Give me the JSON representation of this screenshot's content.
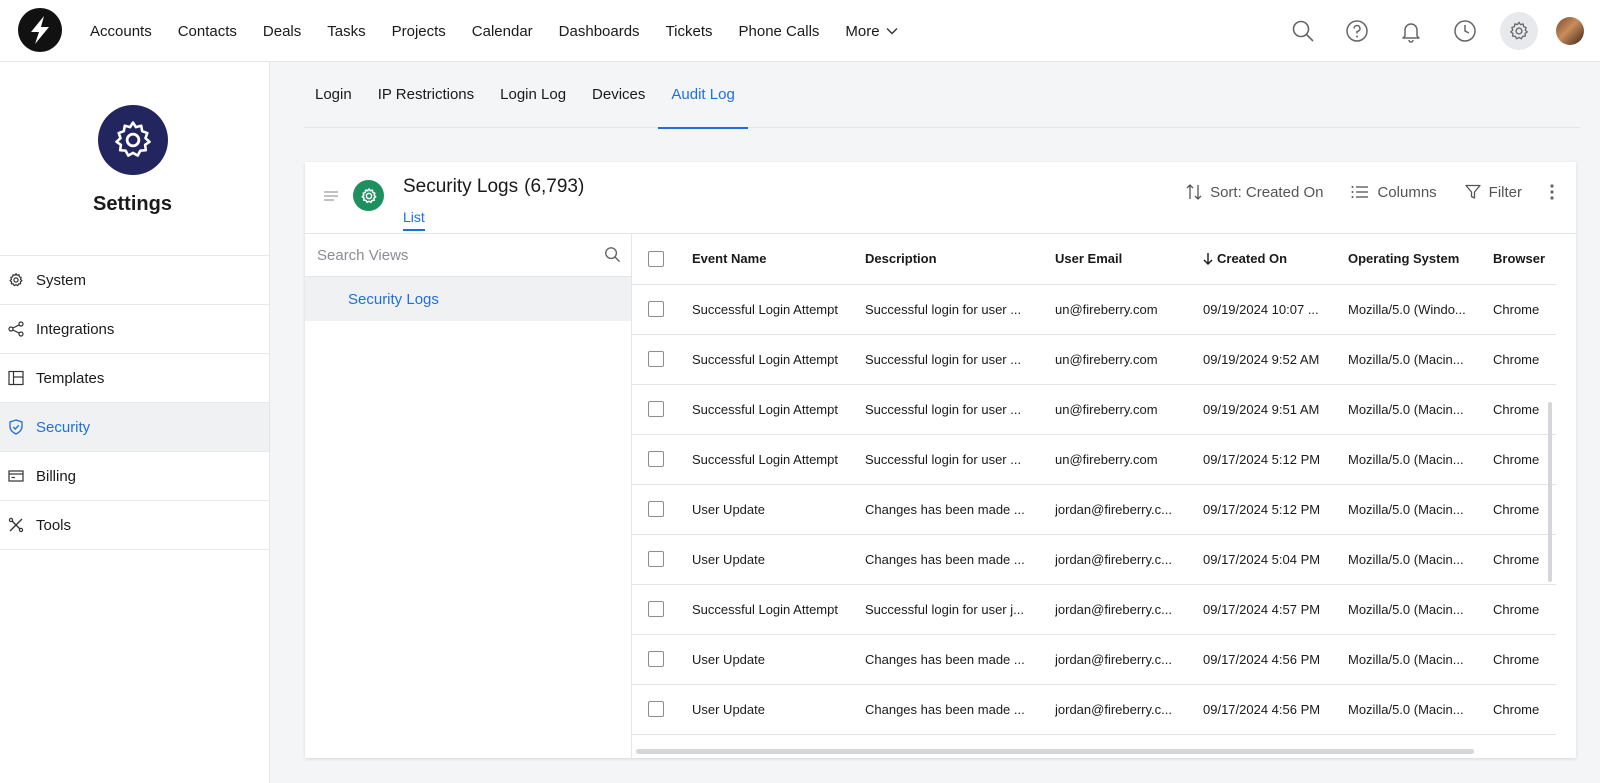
{
  "nav": {
    "items": [
      "Accounts",
      "Contacts",
      "Deals",
      "Tasks",
      "Projects",
      "Calendar",
      "Dashboards",
      "Tickets",
      "Phone Calls"
    ],
    "more_label": "More"
  },
  "top_icons": [
    "search-icon",
    "help-icon",
    "bell-icon",
    "history-icon",
    "gear-icon"
  ],
  "sidebar": {
    "title": "Settings",
    "items": [
      {
        "label": "System",
        "icon": "gear-icon"
      },
      {
        "label": "Integrations",
        "icon": "share-icon"
      },
      {
        "label": "Templates",
        "icon": "layout-icon"
      },
      {
        "label": "Security",
        "icon": "shield-icon",
        "active": true
      },
      {
        "label": "Billing",
        "icon": "card-icon"
      },
      {
        "label": "Tools",
        "icon": "tools-icon"
      }
    ]
  },
  "subtabs": [
    "Login",
    "IP Restrictions",
    "Login Log",
    "Devices",
    "Audit Log"
  ],
  "active_subtab": "Audit Log",
  "card": {
    "title": "Security Logs",
    "count": "(6,793)",
    "view_tab": "List",
    "sort_label": "Sort: Created On",
    "columns_label": "Columns",
    "filter_label": "Filter"
  },
  "views": {
    "search_placeholder": "Search Views",
    "items": [
      "Security Logs"
    ]
  },
  "table": {
    "headers": [
      "Event Name",
      "Description",
      "User Email",
      "Created On",
      "Operating System",
      "Browser"
    ],
    "sorted_column": "Created On",
    "rows": [
      [
        "Successful Login Attempt",
        "Successful login for user ...",
        "un@fireberry.com",
        "09/19/2024 10:07 ...",
        "Mozilla/5.0 (Windo...",
        "Chrome"
      ],
      [
        "Successful Login Attempt",
        "Successful login for user ...",
        "un@fireberry.com",
        "09/19/2024 9:52 AM",
        "Mozilla/5.0 (Macin...",
        "Chrome"
      ],
      [
        "Successful Login Attempt",
        "Successful login for user ...",
        "un@fireberry.com",
        "09/19/2024 9:51 AM",
        "Mozilla/5.0 (Macin...",
        "Chrome"
      ],
      [
        "Successful Login Attempt",
        "Successful login for user ...",
        "un@fireberry.com",
        "09/17/2024 5:12 PM",
        "Mozilla/5.0 (Macin...",
        "Chrome"
      ],
      [
        "User Update",
        "Changes has been made ...",
        "jordan@fireberry.c...",
        "09/17/2024 5:12 PM",
        "Mozilla/5.0 (Macin...",
        "Chrome"
      ],
      [
        "User Update",
        "Changes has been made ...",
        "jordan@fireberry.c...",
        "09/17/2024 5:04 PM",
        "Mozilla/5.0 (Macin...",
        "Chrome"
      ],
      [
        "Successful Login Attempt",
        "Successful login for user j...",
        "jordan@fireberry.c...",
        "09/17/2024 4:57 PM",
        "Mozilla/5.0 (Macin...",
        "Chrome"
      ],
      [
        "User Update",
        "Changes has been made ...",
        "jordan@fireberry.c...",
        "09/17/2024 4:56 PM",
        "Mozilla/5.0 (Macin...",
        "Chrome"
      ],
      [
        "User Update",
        "Changes has been made ...",
        "jordan@fireberry.c...",
        "09/17/2024 4:56 PM",
        "Mozilla/5.0 (Macin...",
        "Chrome"
      ]
    ]
  },
  "colors": {
    "accent": "#1f6fde",
    "settings_badge": "#23265e",
    "card_badge": "#1e8f5e"
  }
}
